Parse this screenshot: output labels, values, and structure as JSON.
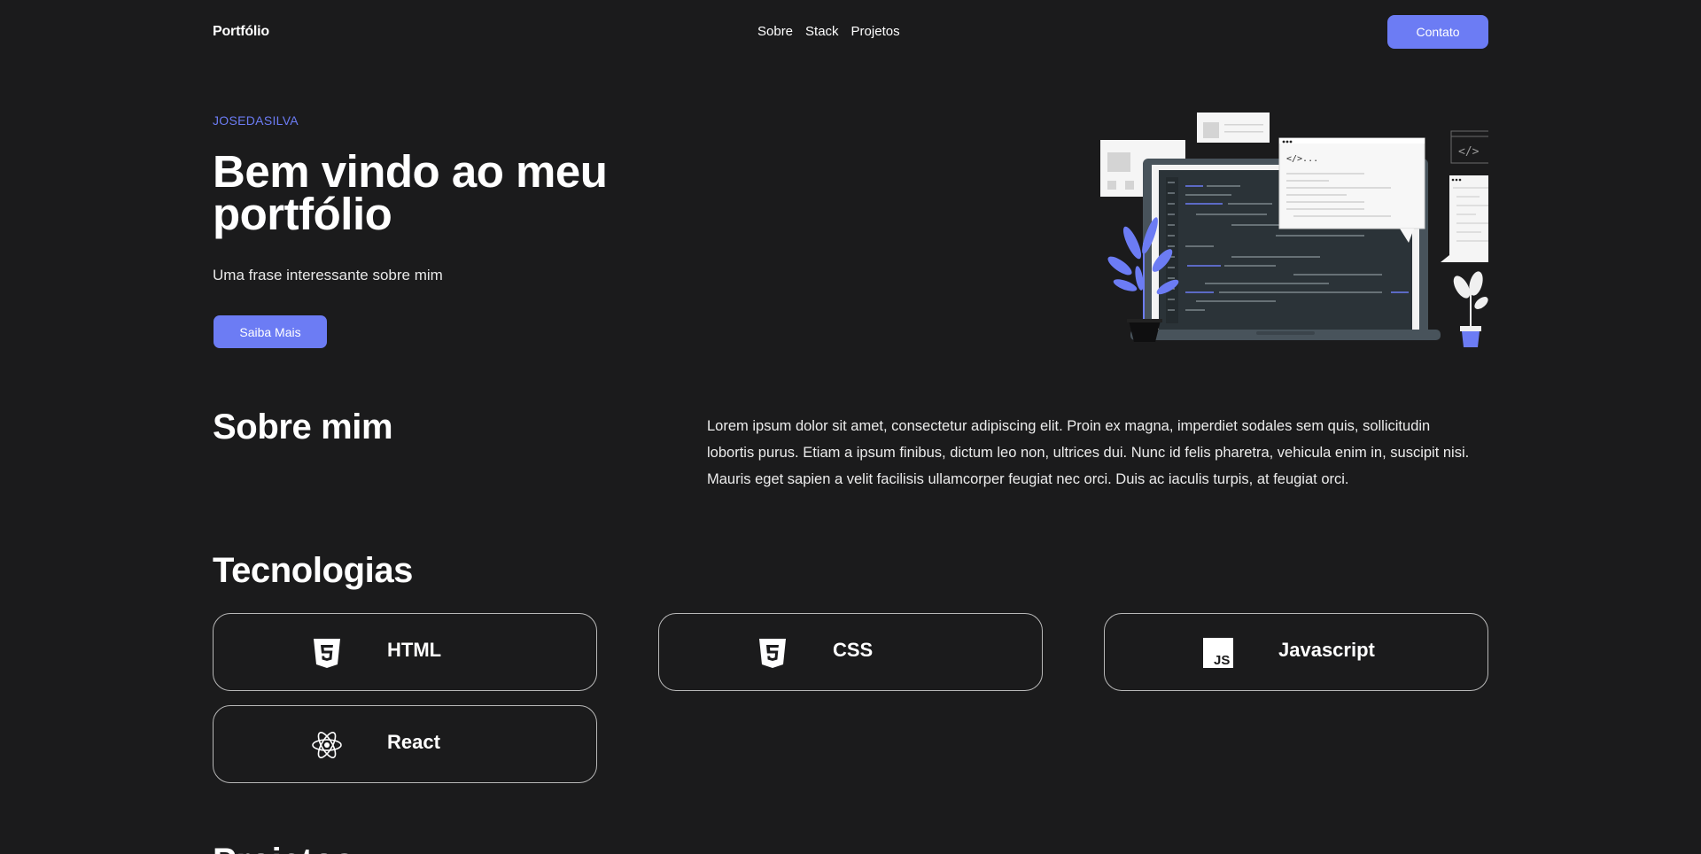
{
  "nav": {
    "logo": "Portfólio",
    "links": [
      "Sobre",
      "Stack",
      "Projetos"
    ],
    "contact_label": "Contato"
  },
  "hero": {
    "kicker": "JOSEDASILVA",
    "title": "Bem vindo ao meu portfólio",
    "subtitle": "Uma frase interessante sobre mim",
    "button_label": "Saiba Mais"
  },
  "about": {
    "title": "Sobre mim",
    "text": "Lorem ipsum dolor sit amet, consectetur adipiscing elit. Proin ex magna, imperdiet sodales sem quis, sollicitudin lobortis purus. Etiam a ipsum finibus, dictum leo non, ultrices dui. Nunc id felis pharetra, vehicula enim in, suscipit nisi. Mauris eget sapien a velit facilisis ullamcorper feugiat nec orci. Duis ac iaculis turpis, at feugiat orci."
  },
  "tech": {
    "title": "Tecnologias",
    "items": [
      {
        "name": "HTML",
        "icon": "html5-icon"
      },
      {
        "name": "CSS",
        "icon": "css3-icon"
      },
      {
        "name": "Javascript",
        "icon": "javascript-icon"
      },
      {
        "name": "React",
        "icon": "react-icon"
      }
    ]
  },
  "next_section": {
    "title": "Projetos"
  },
  "colors": {
    "background": "#1b1b1c",
    "accent": "#6c7cf4",
    "text": "#ffffff"
  }
}
